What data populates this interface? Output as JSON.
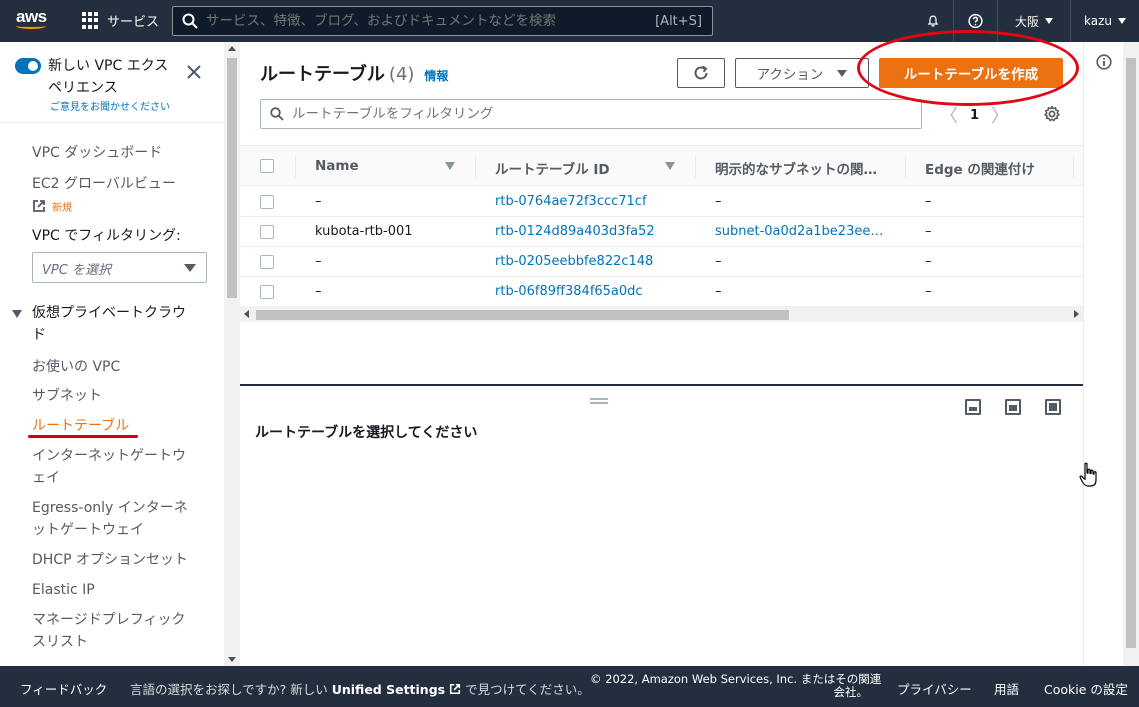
{
  "topnav": {
    "logo_text": "aws",
    "services_label": "サービス",
    "search_placeholder": "サービス、特徴、ブログ、およびドキュメントなどを検索",
    "search_shortcut": "[Alt+S]",
    "region_label": "大阪",
    "user_label": "kazu"
  },
  "sidebar": {
    "toggle_title": "新しい VPC エクスペリエンス",
    "feedback_link": "ご意見をお聞かせください",
    "dashboard": "VPC ダッシュボード",
    "ec2_global_view": "EC2 グローバルビュー",
    "new_badge": "新規",
    "filter_label": "VPC でフィルタリング:",
    "vpc_select_placeholder": "VPC を選択",
    "section_title": "仮想プライベートクラウド",
    "items": [
      "お使いの VPC",
      "サブネット",
      "ルートテーブル",
      "インターネットゲートウェイ",
      "Egress-only インターネットゲートウェイ",
      "DHCP オプションセット",
      "Elastic IP",
      "マネージドプレフィックスリスト"
    ],
    "active_item": "ルートテーブル"
  },
  "main": {
    "title": "ルートテーブル",
    "count": "(4)",
    "info_link": "情報",
    "actions_label": "アクション",
    "create_label": "ルートテーブルを作成",
    "filter_placeholder": "ルートテーブルをフィルタリング",
    "page_number": "1",
    "columns": [
      "Name",
      "ルートテーブル ID",
      "明示的なサブネットの関…",
      "Edge の関連付け"
    ],
    "rows": [
      {
        "name": "–",
        "id": "rtb-0764ae72f3ccc71cf",
        "subnet": "–",
        "edge": "–"
      },
      {
        "name": "kubota-rtb-001",
        "id": "rtb-0124d89a403d3fa52",
        "subnet": "subnet-0a0d2a1be23ee…",
        "edge": "–"
      },
      {
        "name": "–",
        "id": "rtb-0205eebbfe822c148",
        "subnet": "–",
        "edge": "–"
      },
      {
        "name": "–",
        "id": "rtb-06f89ff384f65a0dc",
        "subnet": "–",
        "edge": "–"
      }
    ],
    "detail_prompt": "ルートテーブルを選択してください"
  },
  "footer": {
    "feedback": "フィードバック",
    "lang_prefix": "言語の選択をお探しですか? 新しい",
    "lang_bold": "Unified Settings",
    "lang_suffix": "で見つけてください。",
    "copyright_line1": "© 2022, Amazon Web Services, Inc. またはその関連",
    "copyright_line2": "会社。",
    "privacy": "プライバシー",
    "terms": "用語",
    "cookie": "Cookie の設定"
  },
  "colors": {
    "nav_bg": "#232f3e",
    "accent_orange": "#ec7211",
    "link_blue": "#0073bb",
    "annotation_red": "#e30613"
  }
}
